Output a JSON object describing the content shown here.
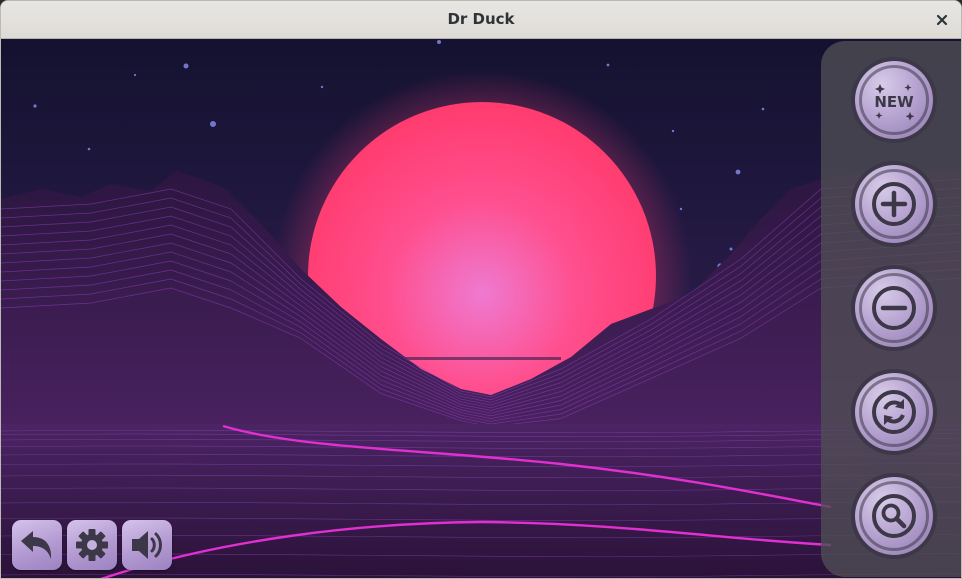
{
  "window": {
    "title": "Dr Duck",
    "close_icon": "close-icon"
  },
  "side_panel": {
    "buttons": [
      {
        "id": "new",
        "icon": "new-icon",
        "text": "NEW"
      },
      {
        "id": "zoom-in",
        "icon": "plus-icon"
      },
      {
        "id": "zoom-out",
        "icon": "minus-icon"
      },
      {
        "id": "refresh",
        "icon": "refresh-icon"
      },
      {
        "id": "search",
        "icon": "magnifier-icon"
      }
    ]
  },
  "bottom_toolbar": {
    "buttons": [
      {
        "id": "back",
        "icon": "back-arrow-icon"
      },
      {
        "id": "settings",
        "icon": "gear-icon"
      },
      {
        "id": "sound",
        "icon": "speaker-icon"
      }
    ]
  },
  "colors": {
    "sky": "#1a1635",
    "sun": "#ff3c78",
    "sun_core": "#ee7ad0",
    "grid": "#b04ad8",
    "neon_line": "#e030d0",
    "button_fill": "#b7a4d1",
    "button_dark": "#3c3848"
  }
}
